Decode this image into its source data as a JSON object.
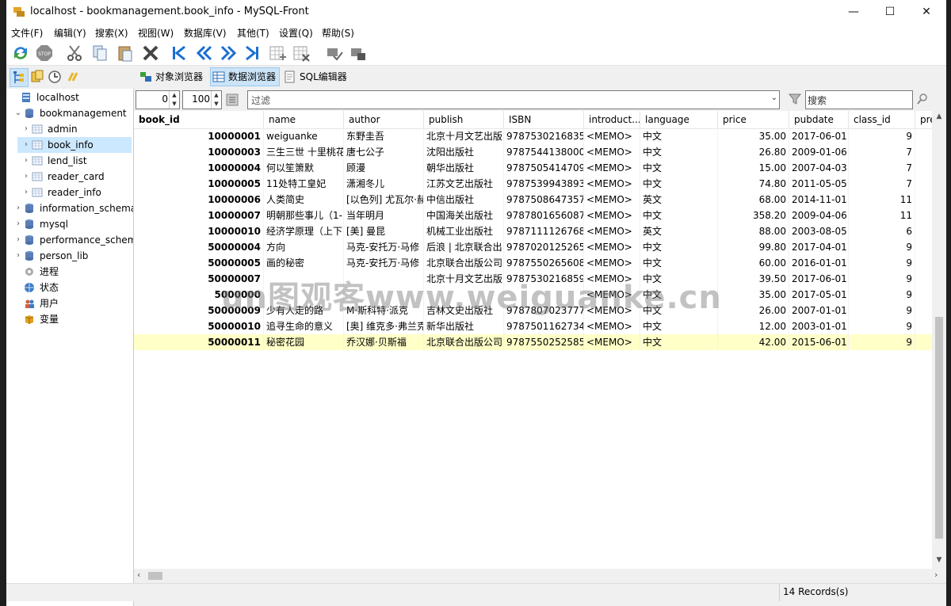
{
  "window": {
    "title": "localhost - bookmanagement.book_info - MySQL-Front",
    "minimize": "—",
    "maximize": "☐",
    "close": "✕"
  },
  "menu": [
    "文件(F)",
    "编辑(Y)",
    "搜索(X)",
    "视图(W)",
    "数据库(V)",
    "其他(T)",
    "设置(Q)",
    "帮助(S)"
  ],
  "tabs": {
    "objects": "对象浏览器",
    "data": "数据浏览器",
    "sql": "SQL编辑器"
  },
  "tree": [
    {
      "label": "localhost",
      "icon": "server-icon",
      "level": 0,
      "arrow": ""
    },
    {
      "label": "bookmanagement",
      "icon": "database-icon",
      "level": 1,
      "arrow": "v"
    },
    {
      "label": "admin",
      "icon": "table-icon",
      "level": 2,
      "arrow": ">"
    },
    {
      "label": "book_info",
      "icon": "table-icon",
      "level": 2,
      "arrow": ">",
      "selected": true
    },
    {
      "label": "lend_list",
      "icon": "table-icon",
      "level": 2,
      "arrow": ">"
    },
    {
      "label": "reader_card",
      "icon": "table-icon",
      "level": 2,
      "arrow": ">"
    },
    {
      "label": "reader_info",
      "icon": "table-icon",
      "level": 2,
      "arrow": ">"
    },
    {
      "label": "information_schema",
      "icon": "database-icon",
      "level": 1,
      "arrow": ">"
    },
    {
      "label": "mysql",
      "icon": "database-icon",
      "level": 1,
      "arrow": ">"
    },
    {
      "label": "performance_schema",
      "icon": "database-icon",
      "level": 1,
      "arrow": ">"
    },
    {
      "label": "person_lib",
      "icon": "database-icon",
      "level": 1,
      "arrow": ">"
    },
    {
      "label": "进程",
      "icon": "process-icon",
      "level": 1,
      "arrow": ""
    },
    {
      "label": "状态",
      "icon": "status-icon",
      "level": 1,
      "arrow": ""
    },
    {
      "label": "用户",
      "icon": "users-icon",
      "level": 1,
      "arrow": ""
    },
    {
      "label": "变量",
      "icon": "variables-icon",
      "level": 1,
      "arrow": ""
    }
  ],
  "filter": {
    "offset": "0",
    "limit": "100",
    "filter_placeholder": "过滤",
    "search_placeholder": "搜索"
  },
  "columns": [
    "book_id",
    "name",
    "author",
    "publish",
    "ISBN",
    "introduct...",
    "language",
    "price",
    "pubdate",
    "class_id",
    "pre"
  ],
  "rows": [
    [
      "10000001",
      "weiguanke",
      "东野圭吾",
      "北京十月文艺出版",
      "9787530216835",
      "<MEMO>",
      "中文",
      "35.00",
      "2017-06-01",
      "9"
    ],
    [
      "10000003",
      "三生三世 十里桃花",
      "唐七公子",
      "沈阳出版社",
      "9787544138000",
      "<MEMO>",
      "中文",
      "26.80",
      "2009-01-06",
      "7"
    ],
    [
      "10000004",
      "何以笙箫默",
      "顾漫",
      "朝华出版社",
      "9787505414709",
      "<MEMO>",
      "中文",
      "15.00",
      "2007-04-03",
      "7"
    ],
    [
      "10000005",
      "11处特工皇妃",
      "潇湘冬儿",
      "江苏文艺出版社",
      "9787539943893",
      "<MEMO>",
      "中文",
      "74.80",
      "2011-05-05",
      "7"
    ],
    [
      "10000006",
      "人类简史",
      "[以色列] 尤瓦尔·赫",
      "中信出版社",
      "9787508647357",
      "<MEMO>",
      "英文",
      "68.00",
      "2014-11-01",
      "11"
    ],
    [
      "10000007",
      "明朝那些事儿（1-",
      "当年明月",
      "中国海关出版社",
      "9787801656087",
      "<MEMO>",
      "中文",
      "358.20",
      "2009-04-06",
      "11"
    ],
    [
      "10000010",
      "经济学原理（上下",
      "[美] 曼昆",
      "机械工业出版社",
      "9787111126768",
      "<MEMO>",
      "英文",
      "88.00",
      "2003-08-05",
      "6"
    ],
    [
      "50000004",
      "方向",
      "马克-安托万·马修",
      "后浪 | 北京联合出",
      "9787020125265",
      "<MEMO>",
      "中文",
      "99.80",
      "2017-04-01",
      "9"
    ],
    [
      "50000005",
      "画的秘密",
      "马克-安托万·马修",
      "北京联合出版公司",
      "9787550265608",
      "<MEMO>",
      "中文",
      "60.00",
      "2016-01-01",
      "9"
    ],
    [
      "50000007",
      "",
      "",
      "北京十月文艺出版",
      "9787530216859",
      "<MEMO>",
      "中文",
      "39.50",
      "2017-06-01",
      "9"
    ],
    [
      "5000000",
      "",
      "",
      "",
      "",
      "<MEMO>",
      "中文",
      "35.00",
      "2017-05-01",
      "9"
    ],
    [
      "50000009",
      "少有人走的路",
      "M·斯科特·派克",
      "吉林文史出版社",
      "9787807023777",
      "<MEMO>",
      "中文",
      "26.00",
      "2007-01-01",
      "9"
    ],
    [
      "50000010",
      "追寻生命的意义",
      "[奥] 维克多·弗兰克",
      "新华出版社",
      "9787501162734",
      "<MEMO>",
      "中文",
      "12.00",
      "2003-01-01",
      "9"
    ],
    [
      "50000011",
      "秘密花园",
      "乔汉娜·贝斯福",
      "北京联合出版公司",
      "9787550252585",
      "<MEMO>",
      "中文",
      "42.00",
      "2015-06-01",
      "9"
    ]
  ],
  "status": {
    "records": "14 Records(s)"
  },
  "watermark": "un图观客www.weiguanke.cn"
}
